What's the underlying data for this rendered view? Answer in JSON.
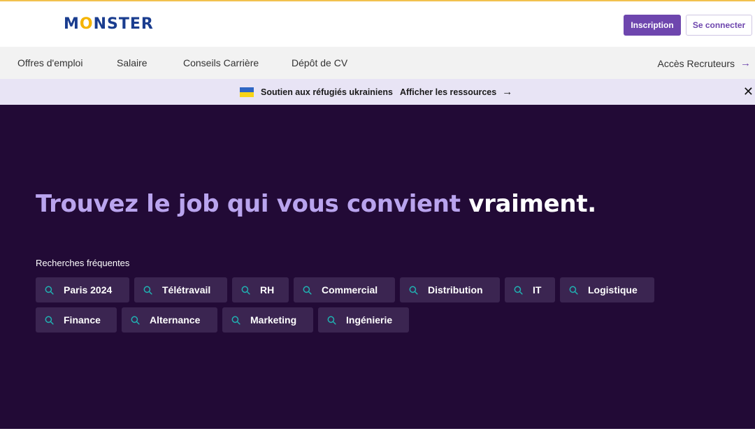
{
  "header": {
    "logo_pre": "M",
    "logo_o": "O",
    "logo_post": "NSTER",
    "signup_label": "Inscription",
    "login_label": "Se connecter"
  },
  "nav": {
    "items": [
      "Offres d'emploi",
      "Salaire",
      "Conseils Carrière",
      "Dépôt de CV"
    ],
    "recruiters_label": "Accès Recruteurs",
    "recruiters_icon": "arrow-right-icon"
  },
  "banner": {
    "text": "Soutien aux réfugiés ukrainiens",
    "link_label": "Afficher les ressources",
    "flag_icon": "ukraine-flag-icon",
    "close_icon": "close-icon"
  },
  "hero": {
    "headline_main": "Trouvez le job qui vous convient ",
    "headline_emphasis": "vraiment",
    "headline_end": ".",
    "searches_label": "Recherches fréquentes",
    "searches": [
      "Paris 2024",
      "Télétravail",
      "RH",
      "Commercial",
      "Distribution",
      "IT",
      "Logistique",
      "Finance",
      "Alternance",
      "Marketing",
      "Ingénierie"
    ]
  },
  "colors": {
    "brand_purple": "#6e46ae",
    "hero_bg": "#220a36",
    "chip_bg": "#3b2551",
    "search_icon": "#1fb3b3",
    "headline_lavender": "#b9a4ee"
  }
}
